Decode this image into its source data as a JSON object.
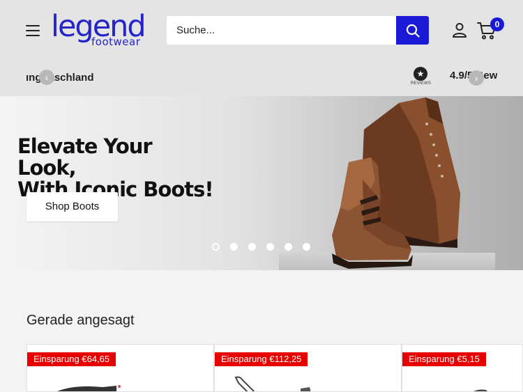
{
  "header": {
    "logo_main": "legend",
    "logo_sub": "footwear",
    "search_placeholder": "Suche...",
    "cart_count": "0"
  },
  "announcement": {
    "text": "ıng   utschland",
    "rating_text": "4.9/5 Bewe",
    "reviews_word": "REVIEWS"
  },
  "hero": {
    "title_lines": [
      "Elevate Your",
      "Look,",
      "With Iconic Boots!"
    ],
    "cta_label": "Shop Boots",
    "slide_count": 6,
    "active_slide": 1
  },
  "section": {
    "title": "Gerade angesagt"
  },
  "products": [
    {
      "sale_label": "Einsparung €64,65"
    },
    {
      "sale_label": "Einsparung €112,25"
    },
    {
      "sale_label": "Einsparung €5,15"
    }
  ],
  "colors": {
    "brand": "#2424c9",
    "accent": "#1a1ad6",
    "sale": "#e60000"
  },
  "icons": [
    "menu-icon",
    "search-icon",
    "account-icon",
    "cart-icon",
    "chevron-left-icon",
    "chevron-right-icon",
    "star-icon"
  ]
}
